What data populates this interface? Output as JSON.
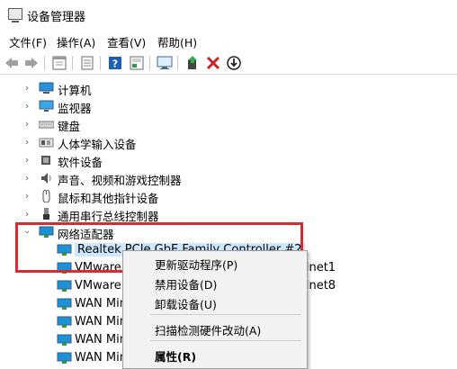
{
  "window": {
    "title": "设备管理器"
  },
  "menu": [
    {
      "label": "文件(F)"
    },
    {
      "label": "操作(A)"
    },
    {
      "label": "查看(V)"
    },
    {
      "label": "帮助(H)"
    }
  ],
  "toolbar": {
    "buttons": [
      "back-icon",
      "forward-icon",
      "properties-icon",
      "list-icon",
      "help-icon",
      "details-icon",
      "monitor-scan-icon",
      "update-driver-icon",
      "uninstall-icon",
      "download-icon"
    ]
  },
  "tree": {
    "categories": [
      {
        "label": "计算机",
        "icon": "computer-icon"
      },
      {
        "label": "监视器",
        "icon": "monitor-icon"
      },
      {
        "label": "键盘",
        "icon": "keyboard-icon"
      },
      {
        "label": "人体学输入设备",
        "icon": "hid-icon"
      },
      {
        "label": "软件设备",
        "icon": "software-device-icon"
      },
      {
        "label": "声音、视频和游戏控制器",
        "icon": "speaker-icon"
      },
      {
        "label": "鼠标和其他指针设备",
        "icon": "mouse-icon"
      },
      {
        "label": "通用串行总线控制器",
        "icon": "usb-icon"
      }
    ],
    "expanded": {
      "label": "网络适配器",
      "icon": "network-adapter-icon"
    },
    "adapters": [
      {
        "label": "Realtek PCIe GbE Family Controller #2",
        "selected": true
      },
      {
        "label": "VMware Virtual Ethernet Adapter for VMnet1"
      },
      {
        "label": "VMware Virtual Ethernet Adapter for VMnet8"
      },
      {
        "label": "WAN Miniport (IKEv2)"
      },
      {
        "label": "WAN Miniport (IP)"
      },
      {
        "label": "WAN Miniport (IPv6)"
      },
      {
        "label": "WAN Miniport (L2TP)"
      }
    ]
  },
  "context_menu": {
    "update_driver": "更新驱动程序(P)",
    "disable": "禁用设备(D)",
    "uninstall": "卸载设备(U)",
    "scan": "扫描检测硬件改动(A)",
    "properties": "属性(R)"
  },
  "colors": {
    "highlight": "#e0282d",
    "selection": "#cce8ff",
    "icon_blue": "#1e90d8"
  }
}
